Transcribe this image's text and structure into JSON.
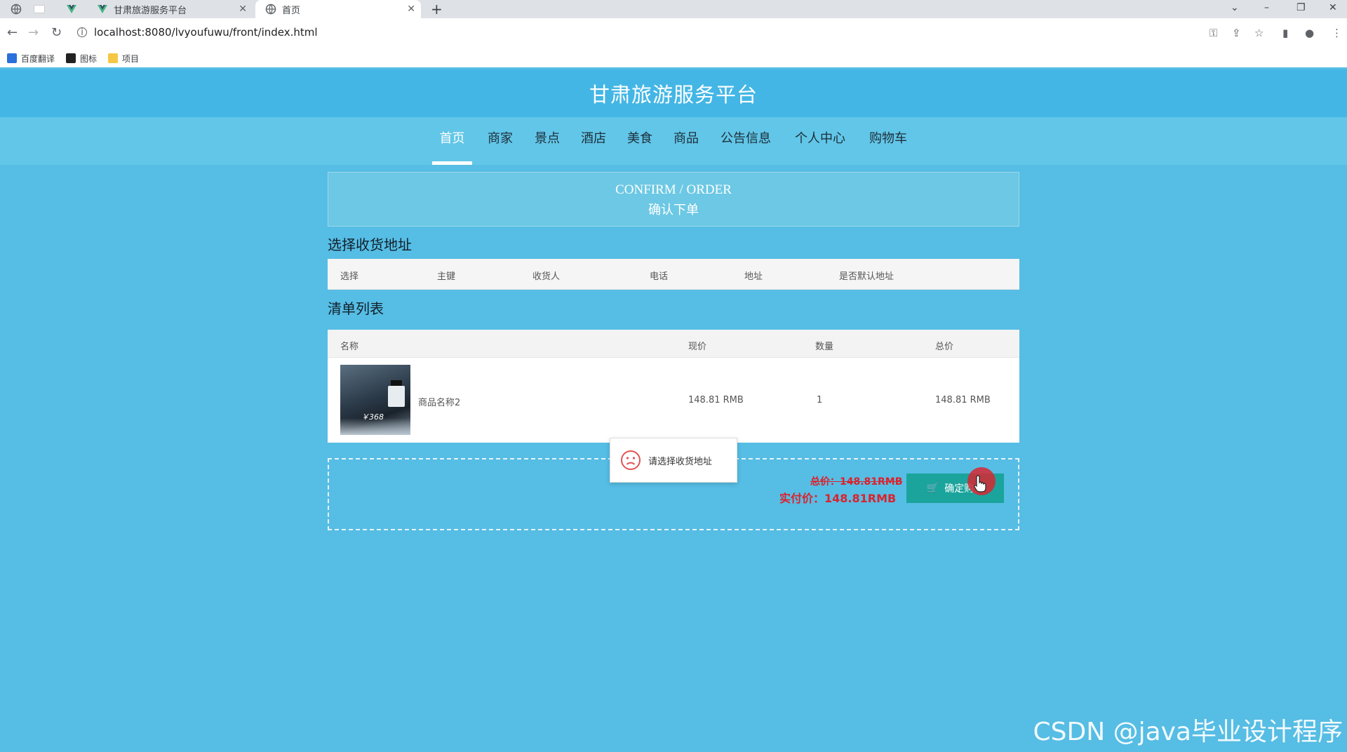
{
  "browser": {
    "tabs": [
      {
        "title": "甘肃旅游服务平台",
        "active": false
      },
      {
        "title": "首页",
        "active": true
      }
    ],
    "url": "localhost:8080/lvyoufuwu/front/index.html",
    "bookmarks": [
      "百度翻译",
      "图标",
      "项目"
    ]
  },
  "site": {
    "title": "甘肃旅游服务平台",
    "nav": [
      "首页",
      "商家",
      "景点",
      "酒店",
      "美食",
      "商品",
      "公告信息",
      "个人中心",
      "购物车"
    ],
    "active_nav": "首页"
  },
  "banner": {
    "en": "CONFIRM / ORDER",
    "cn": "确认下单"
  },
  "address": {
    "section_title": "选择收货地址",
    "columns": [
      "选择",
      "主键",
      "收货人",
      "电话",
      "地址",
      "是否默认地址"
    ]
  },
  "order_list": {
    "section_title": "清单列表",
    "columns": [
      "名称",
      "现价",
      "数量",
      "总价"
    ],
    "rows": [
      {
        "name": "商品名称2",
        "price": "148.81 RMB",
        "qty": "1",
        "total": "148.81 RMB",
        "image_text": "￥368"
      }
    ]
  },
  "summary": {
    "total_label": "总价：148.81RMB",
    "pay_label": "实付价：148.81RMB",
    "confirm_label": "确定购买"
  },
  "toast": {
    "message": "请选择收货地址"
  },
  "watermark": "CSDN @java毕业设计程序",
  "colors": {
    "page_bg": "#56bde4",
    "header_bg": "#43b6e5",
    "nav_bg": "#62c6e8",
    "button": "#1aa49c",
    "price_red": "#d9232d"
  }
}
